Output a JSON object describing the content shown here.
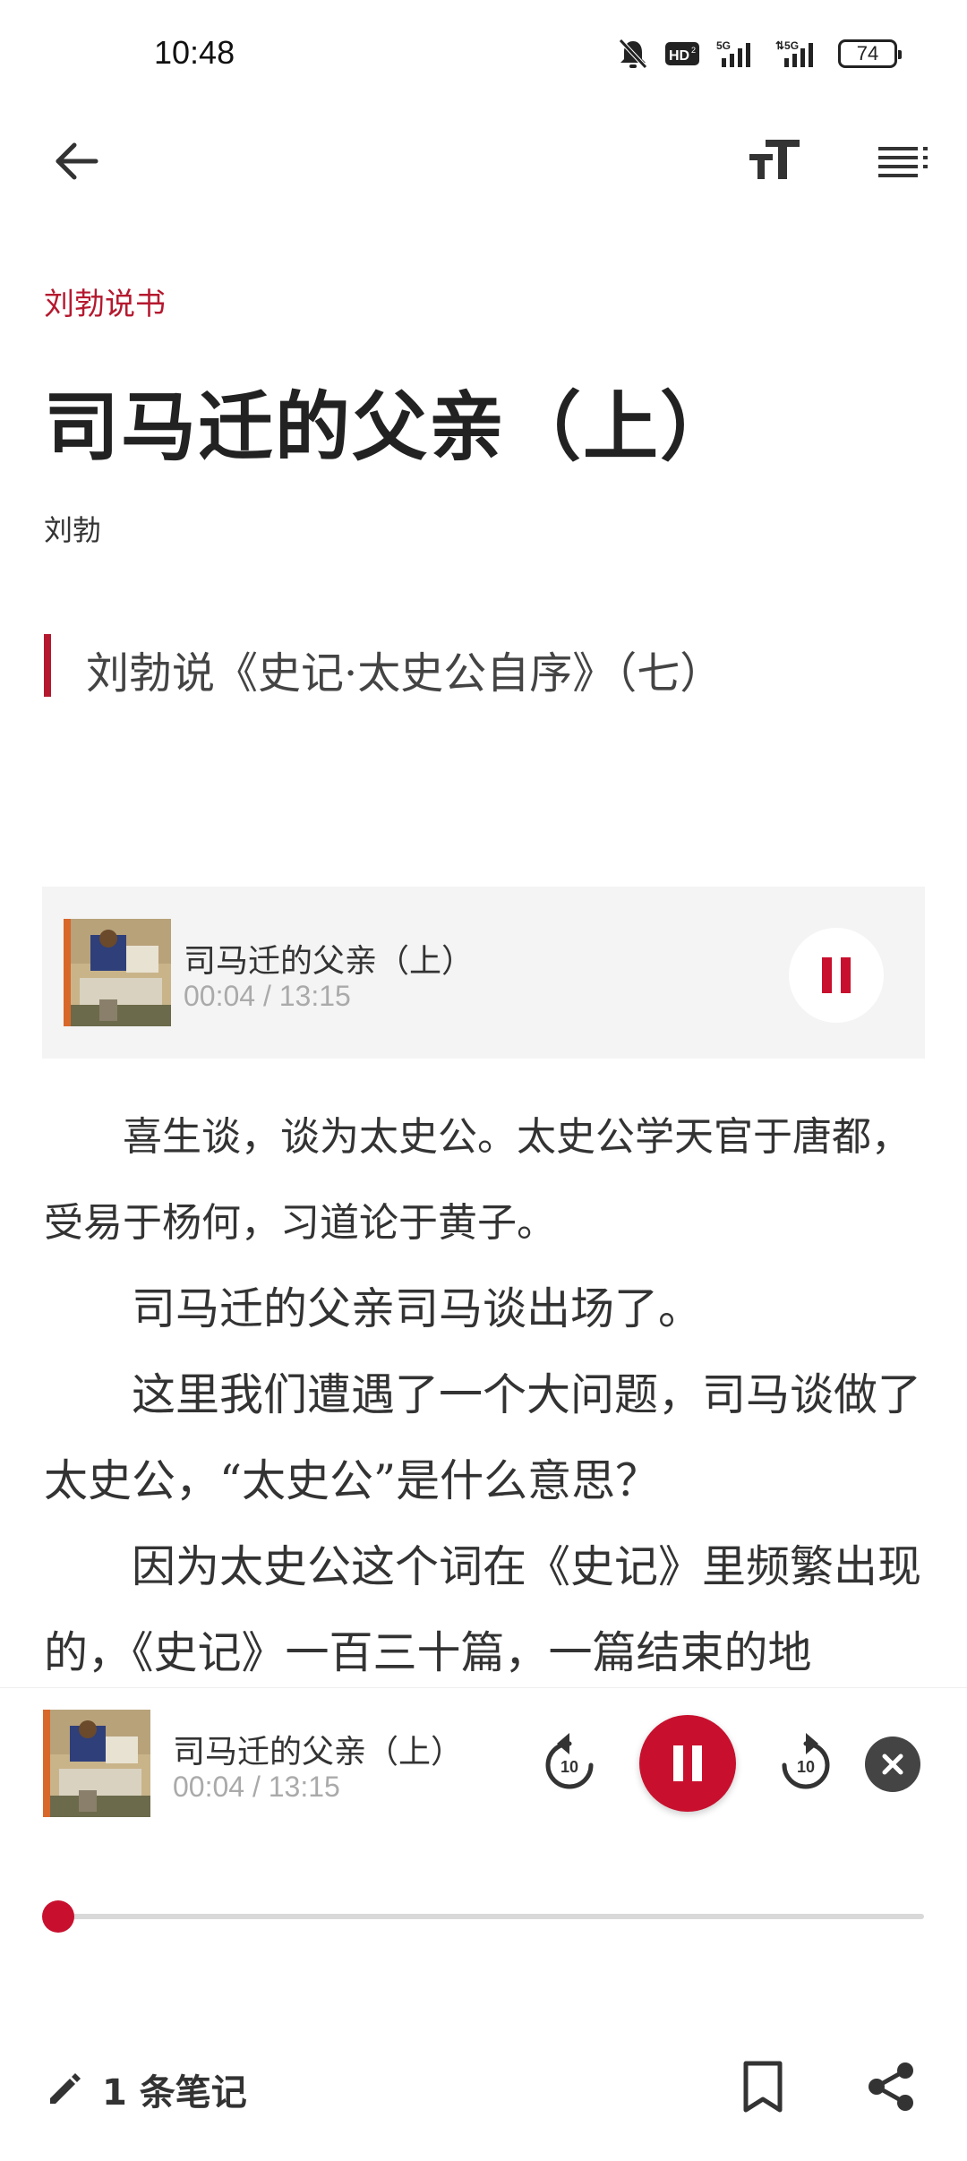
{
  "status_bar": {
    "time": "10:48",
    "battery": "74",
    "icons": [
      "mute-bell-icon",
      "hd-icon",
      "5g-signal-icon",
      "5g-signal-icon",
      "battery-icon"
    ]
  },
  "app_bar": {
    "icons": [
      "back-arrow-icon",
      "font-size-icon",
      "toc-list-icon"
    ]
  },
  "article": {
    "column": "刘勃说书",
    "title": "司马迁的父亲（上）",
    "author": "刘勃",
    "subtitle": "刘勃说《史记·太史公自序》（七）"
  },
  "audio_card": {
    "title": "司马迁的父亲（上）",
    "time": "00:04 / 13:15",
    "state": "playing"
  },
  "body": {
    "paragraphs": [
      "喜生谈，谈为太史公。太史公学天官于唐都，受易于杨何，习道论于黄子。",
      "司马迁的父亲司马谈出场了。",
      "这里我们遭遇了一个大问题，司马谈做了太史公，“太史公”是什么意思？",
      "因为太史公这个词在《史记》里频繁出现的，《史记》一百三十篇，一篇结束的地"
    ]
  },
  "player": {
    "title": "司马迁的父亲（上）",
    "time": "00:04 / 13:15",
    "rewind_label": "10",
    "forward_label": "10",
    "progress": 0.005
  },
  "toolbar": {
    "note_count": "1 条笔记"
  },
  "colors": {
    "accent": "#b5192f",
    "play_button": "#c8102e",
    "muted_text": "#aaaaaa"
  }
}
